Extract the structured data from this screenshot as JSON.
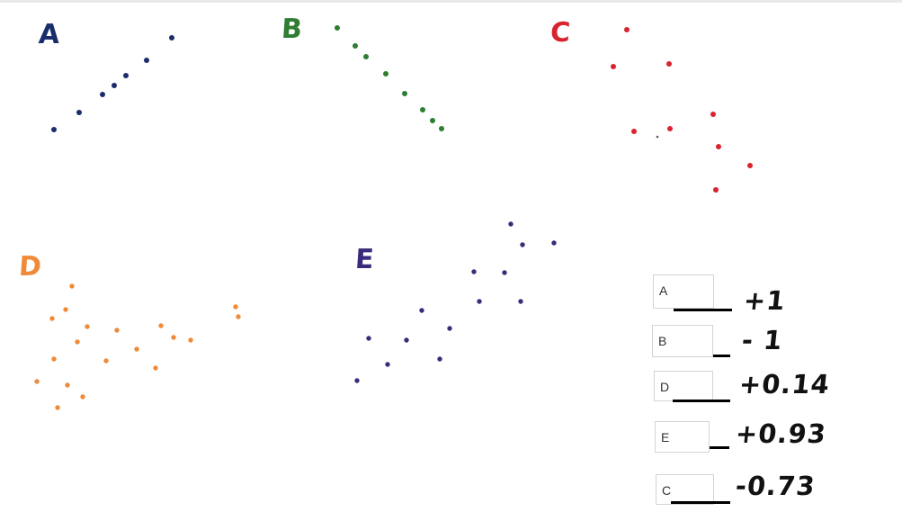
{
  "plots": {
    "A": {
      "label": "A",
      "color": "#1a2d6b"
    },
    "B": {
      "label": "B",
      "color": "#2f7d32"
    },
    "C": {
      "label": "C",
      "color": "#d9232e"
    },
    "D": {
      "label": "D",
      "color": "#f08a38"
    },
    "E": {
      "label": "E",
      "color": "#3c2a7a"
    }
  },
  "matches": [
    {
      "box": "A",
      "value": "+1"
    },
    {
      "box": "B",
      "value": "- 1"
    },
    {
      "box": "D",
      "value": "+0.14"
    },
    {
      "box": "E",
      "value": "+0.93"
    },
    {
      "box": "C",
      "value": "-0.73"
    }
  ]
}
